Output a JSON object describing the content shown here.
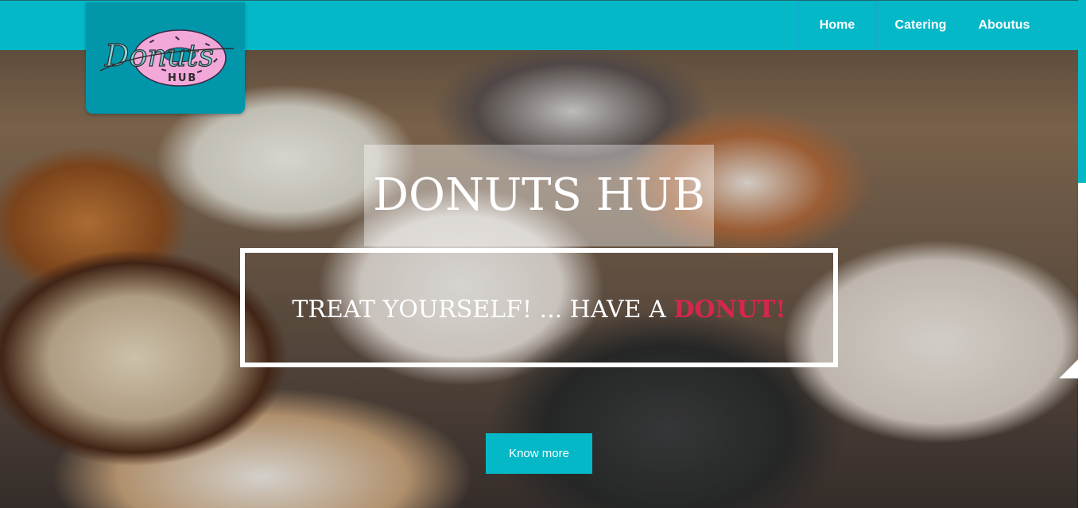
{
  "brand": {
    "logo_script": "Donuts",
    "logo_sub": "HUB"
  },
  "nav": {
    "items": [
      {
        "label": "Home",
        "active": true
      },
      {
        "label": "Catering",
        "active": false
      },
      {
        "label": "Aboutus",
        "active": false
      }
    ]
  },
  "hero": {
    "title": "DONUTS HUB",
    "tagline_prefix": "TREAT YOURSELF! ... HAVE A ",
    "tagline_accent": "DONUT!",
    "button_label": "Know more"
  },
  "colors": {
    "brand_teal": "#04b8c7",
    "logo_bg": "#0196aa",
    "accent_red": "#d6264b",
    "logo_pink": "#f4a6d8"
  }
}
